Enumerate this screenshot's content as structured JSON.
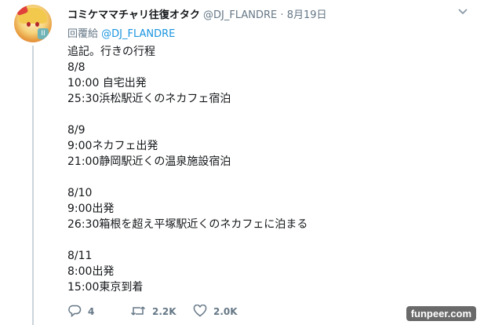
{
  "tweet": {
    "display_name": "コミケママチャリ往復オタク",
    "handle": "@DJ_FLANDRE",
    "separator": "·",
    "date": "8月19日",
    "reply_prefix": "回覆給",
    "reply_to": "@DJ_FLANDRE",
    "lines": [
      "追記。行きの行程",
      "8/8",
      "10:00 自宅出発",
      "25:30浜松駅近くのネカフェ宿泊",
      "",
      "8/9",
      "9:00ネカフェ出発",
      "21:00静岡駅近くの温泉施設宿泊",
      "",
      "8/10",
      "9:00出発",
      "26:30箱根を超え平塚駅近くのネカフェに泊まる",
      "",
      "8/11",
      "8:00出発",
      "15:00東京到着"
    ],
    "reply_count": "4",
    "retweet_count": "2.2K",
    "like_count": "2.0K"
  },
  "avatar_badge": "II",
  "watermark": "funpeer.com"
}
